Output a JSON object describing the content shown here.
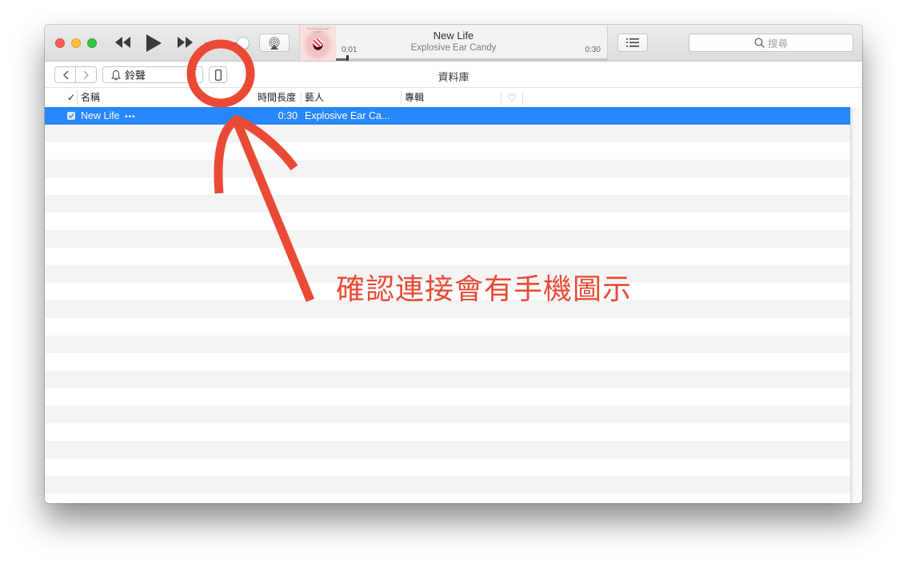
{
  "window": {
    "controls": {
      "close": "close",
      "minimize": "minimize",
      "zoom": "zoom"
    }
  },
  "player": {
    "rewind_icon": "rewind-icon",
    "play_icon": "play-icon",
    "fast_forward_icon": "fast-forward-icon",
    "volume_level": 0.85,
    "airplay_icon": "airplay-icon"
  },
  "now_playing": {
    "title": "New Life",
    "artist": "Explosive Ear Candy",
    "album_art_caption": "EXPLOSIVE EAR CANDY",
    "elapsed": "0:01",
    "duration": "0:30",
    "progress": 0.04
  },
  "toolbar": {
    "list_view_icon": "list-icon",
    "search_placeholder": "搜尋"
  },
  "navbar": {
    "back_label": "<",
    "forward_label": ">",
    "media_kind": "鈴聲",
    "media_icon": "bell-icon",
    "device_icon": "iphone-icon",
    "title": "資料庫"
  },
  "table": {
    "columns": {
      "check": "✓",
      "name": "名稱",
      "time": "時間長度",
      "artist": "藝人",
      "album": "專輯",
      "love": "♡"
    },
    "rows": [
      {
        "checked": true,
        "name": "New Life",
        "more": "•••",
        "time": "0:30",
        "artist": "Explosive Ear Ca...",
        "album": ""
      }
    ]
  },
  "annotation": {
    "text": "確認連接會有手機圖示",
    "color": "#ea4a35"
  },
  "colors": {
    "selection": "#2787fc",
    "annotation": "#ea4a35"
  }
}
